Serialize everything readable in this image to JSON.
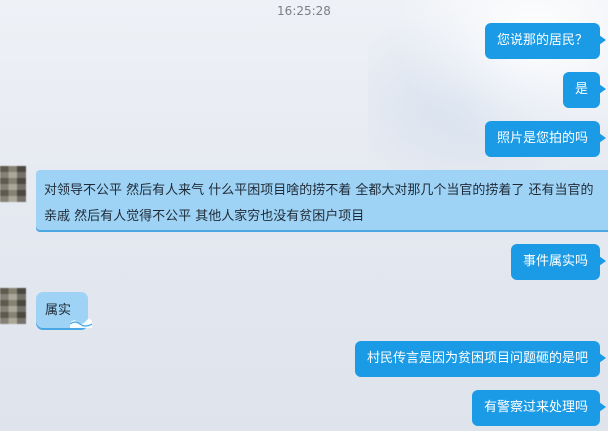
{
  "timestamp": "16:25:28",
  "messages": [
    {
      "side": "right",
      "text": "您说那的居民？"
    },
    {
      "side": "right",
      "text": "是"
    },
    {
      "side": "right",
      "text": "照片是您拍的吗"
    },
    {
      "side": "left",
      "lines": [
        "对领导不公平  然后有人来气  什么平困项目啥的捞不着  全都大对那几个当官的捞着了  还有当官的",
        "亲戚  然后有人觉得不公平  其他人家穷也没有贫困户项目"
      ]
    },
    {
      "side": "right",
      "text": "事件属实吗"
    },
    {
      "side": "left",
      "text": "属实"
    },
    {
      "side": "right",
      "text": "村民传言是因为贫困项目问题砸的是吧"
    },
    {
      "side": "right",
      "text": "有警察过来处理吗"
    }
  ],
  "colors": {
    "right_bubble": "#1b9be6",
    "left_bubble": "#9ed3f5"
  }
}
